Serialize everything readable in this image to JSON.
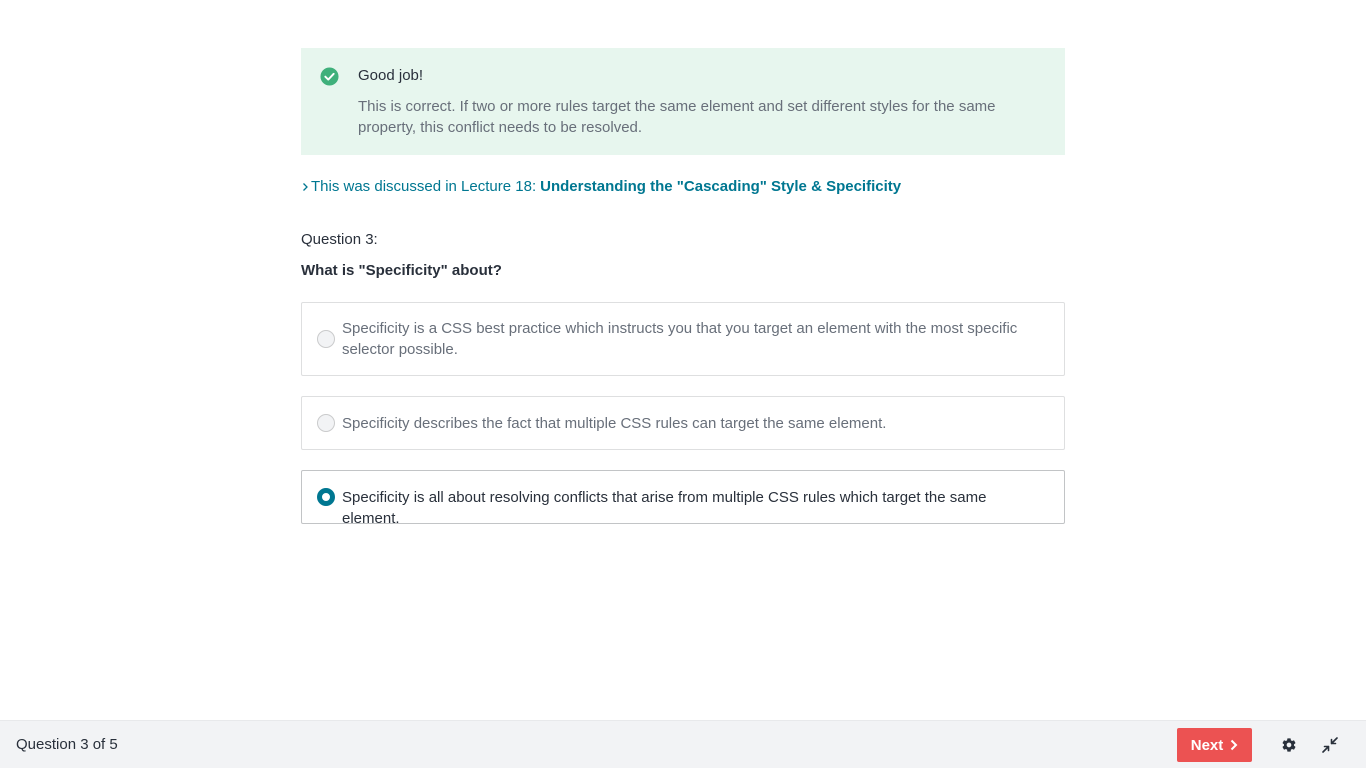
{
  "feedback": {
    "status_icon": "check-circle-icon",
    "title": "Good job!",
    "message": "This is correct. If two or more rules target the same element and set different styles for the same property, this conflict needs to be resolved.",
    "accent_color": "#3fb07b",
    "background_color": "#e7f6ee"
  },
  "lecture_ref": {
    "icon": "chevron-right-icon",
    "prefix": "This was discussed in Lecture 18:",
    "link_text": "Understanding the \"Cascading\" Style & Specificity",
    "color": "#007791"
  },
  "question": {
    "number_label": "Question 3:",
    "text": "What is \"Specificity\" about?",
    "answers": [
      {
        "text": "Specificity is a CSS best practice which instructs you that you target an element with the most specific selector possible.",
        "selected": false
      },
      {
        "text": "Specificity describes the fact that multiple CSS rules can target the same element.",
        "selected": false
      },
      {
        "text": "Specificity is all about resolving conflicts that arise from multiple CSS rules which target the same element.",
        "selected": true
      }
    ]
  },
  "footer": {
    "progress": "Question 3 of 5",
    "next_label": "Next",
    "next_icon": "chevron-right-icon",
    "next_color": "#ec5252",
    "settings_icon": "gear-icon",
    "collapse_icon": "collapse-icon"
  }
}
